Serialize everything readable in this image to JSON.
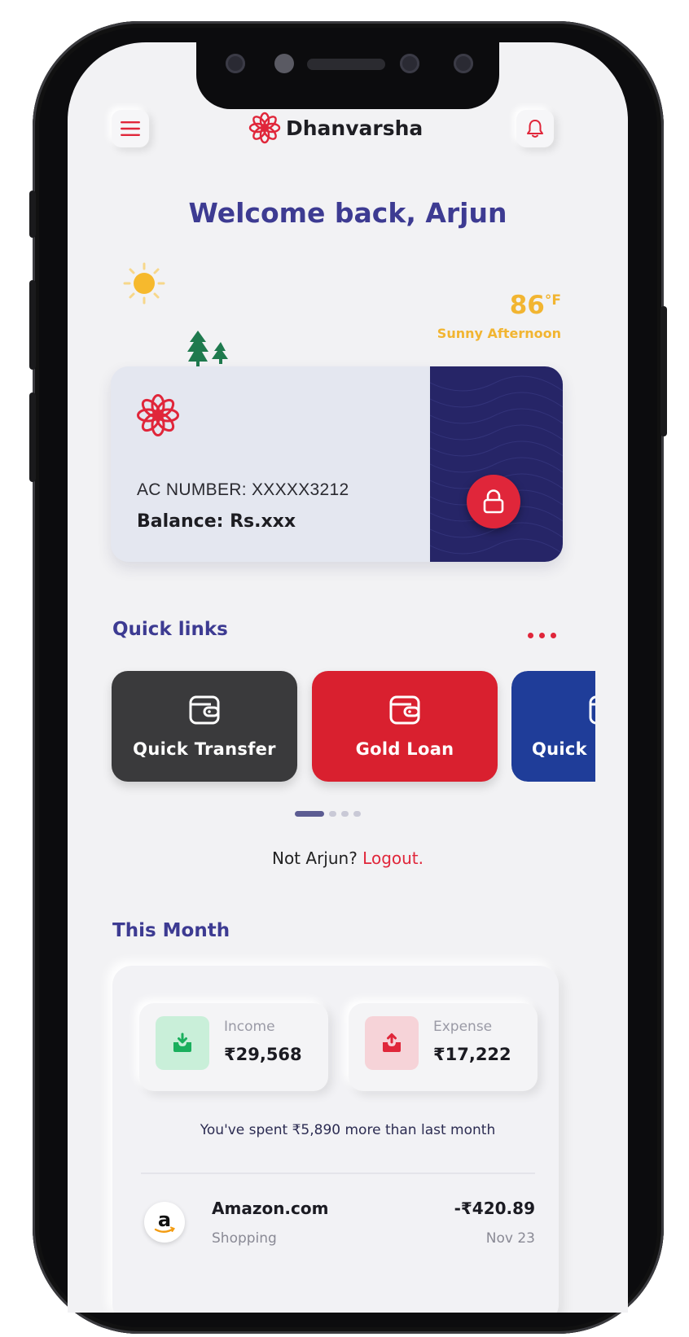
{
  "header": {
    "brand": "Dhanvarsha",
    "menu_icon": "hamburger-icon",
    "notification_icon": "bell-icon"
  },
  "welcome": "Welcome back, Arjun",
  "weather": {
    "temp": "86",
    "unit": "°F",
    "description": "Sunny Afternoon",
    "icon": "sun-icon"
  },
  "account": {
    "number_label": "AC NUMBER: XXXXX3212",
    "balance_label": "Balance: Rs.xxx",
    "lock_icon": "lock-icon"
  },
  "quick_links": {
    "title": "Quick links",
    "items": [
      {
        "label": "Quick Transfer",
        "icon": "wallet-icon",
        "color": "#3a3a3c"
      },
      {
        "label": "Gold Loan",
        "icon": "wallet-icon",
        "color": "#d9202f"
      },
      {
        "label": "Quick",
        "icon": "wallet-icon",
        "color": "#1f3d99"
      }
    ],
    "pager_count": 4,
    "pager_active": 0
  },
  "not_user": {
    "prefix": "Not Arjun?",
    "logout": "Logout."
  },
  "this_month": {
    "title": "This Month",
    "income": {
      "label": "Income",
      "amount": "₹29,568",
      "color": "#1aaf5d"
    },
    "expense": {
      "label": "Expense",
      "amount": "₹17,222",
      "color": "#e0263a"
    },
    "comparison": "You've spent ₹5,890 more than last month"
  },
  "transactions": [
    {
      "merchant": "Amazon.com",
      "category": "Shopping",
      "amount": "-₹420.89",
      "date": "Nov 23",
      "icon": "amazon-logo"
    }
  ],
  "colors": {
    "accent": "#3d3b92",
    "brand_red": "#e0263a",
    "weather": "#f2b531",
    "card_dark": "#262567"
  }
}
